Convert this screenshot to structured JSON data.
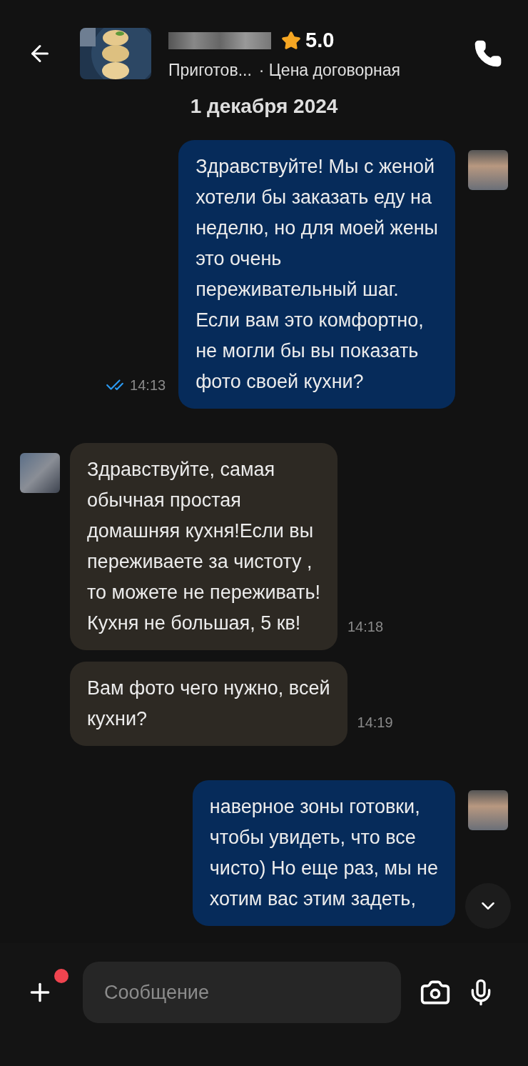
{
  "header": {
    "rating": "5.0",
    "subtitle": "Приготов...",
    "price": "· Цена договорная"
  },
  "date": "1 декабря 2024",
  "messages": [
    {
      "kind": "outgoing",
      "avatar": true,
      "text": "Здравствуйте! Мы с женой\nхотели бы заказать еду на\nнеделю, но для моей жены\nэто очень\nпереживательный шаг.\nЕсли вам это комфортно,\nне могли бы вы показать\nфото своей кухни?",
      "time": "14:13",
      "read": true
    },
    {
      "kind": "incoming",
      "avatar": true,
      "text": "Здравствуйте, самая\nобычная простая\nдомашняя кухня!Если вы\nпереживаете за чистоту ,\n то можете не переживать!\nКухня не большая, 5 кв!",
      "time": "14:18"
    },
    {
      "kind": "incoming",
      "avatar": false,
      "text": "Вам фото чего нужно, всей\nкухни?",
      "time": "14:19"
    },
    {
      "kind": "outgoing",
      "avatar": true,
      "text": "наверное зоны готовки,\nчтобы увидеть, что все\nчисто) Но еще раз, мы не\nхотим вас этим задеть,"
    }
  ],
  "composer": {
    "placeholder": "Сообщение",
    "attach_badge": true
  }
}
